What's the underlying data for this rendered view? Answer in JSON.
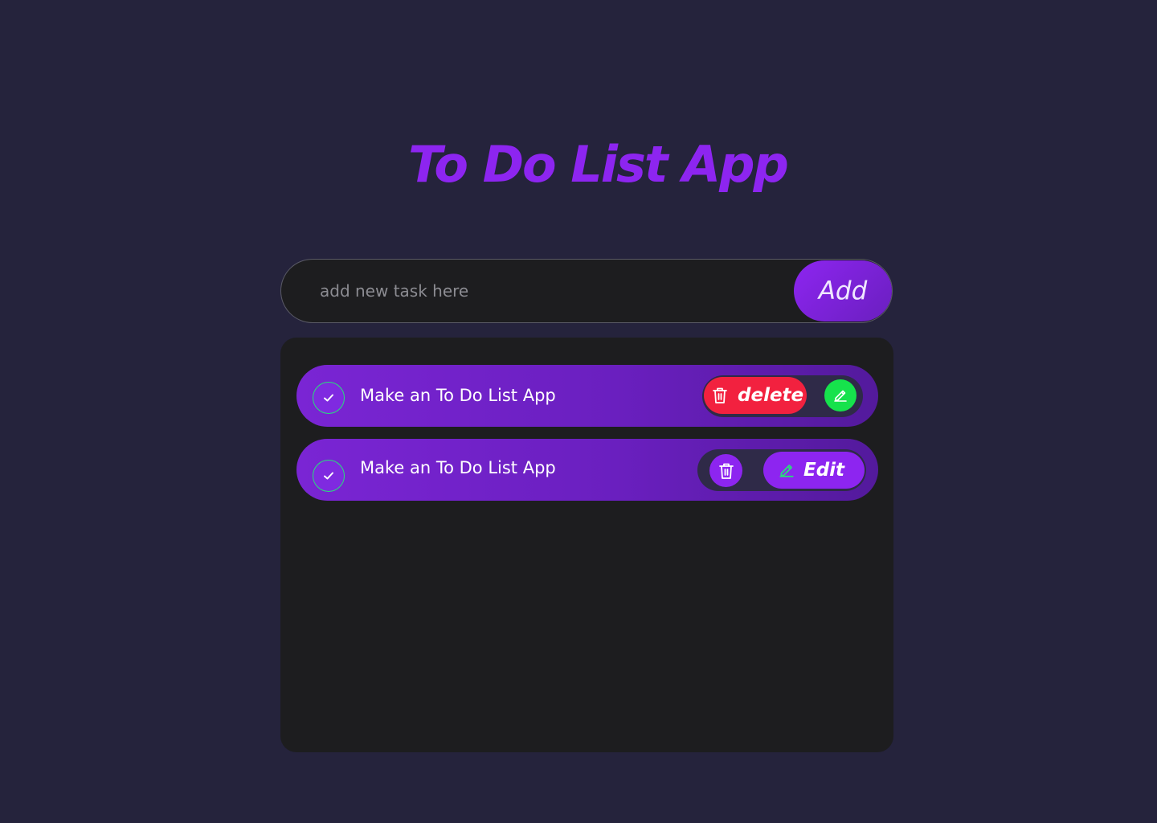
{
  "app": {
    "title": "To Do List App"
  },
  "add_bar": {
    "placeholder": "add new task here",
    "value": "",
    "add_label": "Add"
  },
  "tasks": [
    {
      "text": "Make an To Do List App",
      "delete_label": "delete"
    },
    {
      "text": "Make an To Do List App",
      "edit_label": "Edit"
    }
  ],
  "icons": {
    "check": "check-icon",
    "trash": "trash-icon",
    "edit": "pencil-icon"
  },
  "colors": {
    "background": "#25233c",
    "panel": "#1d1d1f",
    "accent": "#8d25f0",
    "task_bg": "#7a25d4",
    "delete": "#f2213f",
    "edit_green": "#16e24c",
    "check_border": "#27e07a"
  }
}
